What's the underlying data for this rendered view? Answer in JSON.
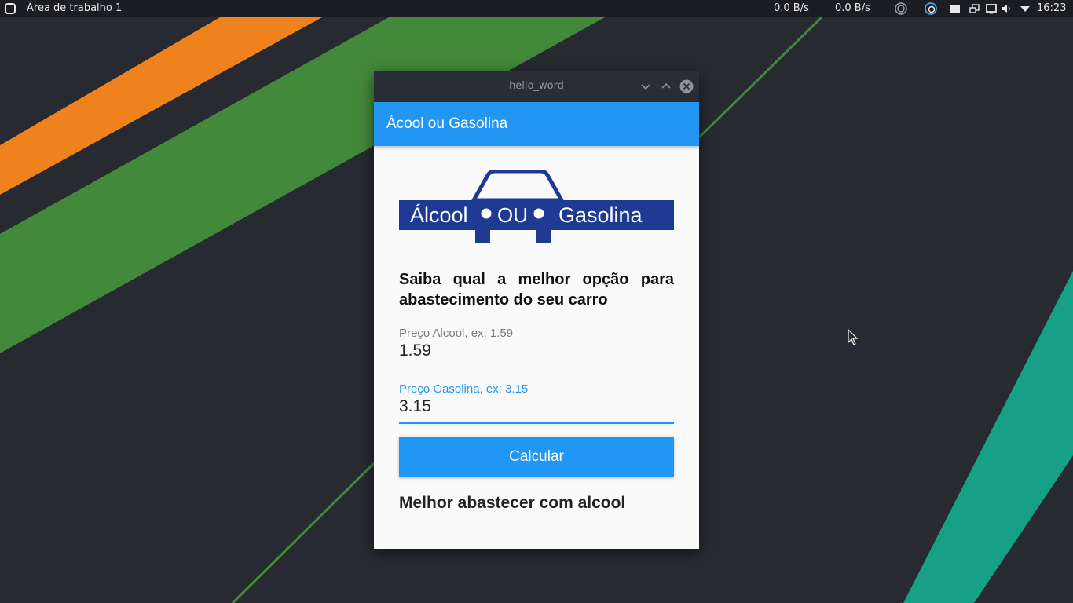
{
  "panel": {
    "desktop_name": "Área de trabalho 1",
    "net_down": "0.0 B/s",
    "net_up": "0.0 B/s",
    "clock": "16:23",
    "tray_icons": [
      "network-monitor-icon",
      "sync-icon",
      "files-icon",
      "windows-icon",
      "display-icon",
      "volume-icon",
      "menu-down-icon"
    ]
  },
  "window": {
    "title": "hello_word"
  },
  "app": {
    "title": "Ácool ou Gasolina",
    "logo": {
      "word_left": "Álcool",
      "word_mid": "OU",
      "word_right": "Gasolina",
      "color": "#1f3a93"
    },
    "headline": "Saiba qual a melhor opção para abastecimento do seu carro",
    "alcool_field": {
      "label": "Preço Alcool, ex: 1.59",
      "value": "1.59"
    },
    "gasolina_field": {
      "label": "Preço Gasolina, ex: 3.15",
      "value": "3.15"
    },
    "button_label": "Calcular",
    "result": "Melhor abastecer com alcool"
  },
  "colors": {
    "primary": "#2196f3",
    "orange": "#f0821e",
    "green": "#43893a",
    "teal": "#16a085",
    "background": "#272a30"
  }
}
